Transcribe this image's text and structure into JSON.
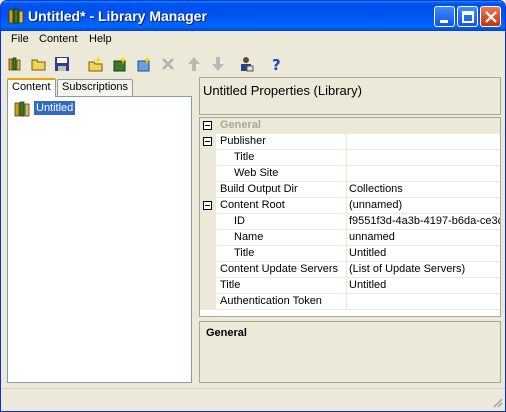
{
  "window": {
    "title": "Untitled* - Library Manager"
  },
  "menu": [
    {
      "label": "File"
    },
    {
      "label": "Content"
    },
    {
      "label": "Help"
    }
  ],
  "toolbar": {
    "icons": [
      "open-library-icon",
      "open-folder-icon",
      "save-icon",
      "new-content-icon",
      "new-item-icon",
      "new-update-server-icon",
      "delete-icon",
      "move-up-icon",
      "move-down-icon",
      "user-settings-icon",
      "help-icon"
    ]
  },
  "left": {
    "tabs": [
      {
        "label": "Content",
        "active": true
      },
      {
        "label": "Subscriptions",
        "active": false
      }
    ],
    "tree": {
      "label": "Untitled"
    }
  },
  "properties": {
    "header": "Untitled Properties (Library)",
    "rows": [
      {
        "name": "General",
        "value": "",
        "category": true
      },
      {
        "name": "Publisher",
        "value": "",
        "expandable": true
      },
      {
        "name": "Title",
        "value": "",
        "indent": 1
      },
      {
        "name": "Web Site",
        "value": "",
        "indent": 1
      },
      {
        "name": "Build Output Dir",
        "value": "Collections"
      },
      {
        "name": "Content Root",
        "value": "(unnamed)",
        "expandable": true
      },
      {
        "name": "ID",
        "value": "f9551f3d-4a3b-4197-b6da-ce3c",
        "indent": 1
      },
      {
        "name": "Name",
        "value": "unnamed",
        "indent": 1
      },
      {
        "name": "Title",
        "value": "Untitled",
        "indent": 1
      },
      {
        "name": "Content Update Servers",
        "value": "(List of Update Servers)"
      },
      {
        "name": "Title",
        "value": "Untitled"
      },
      {
        "name": "Authentication Token",
        "value": ""
      }
    ],
    "description_title": "General"
  }
}
